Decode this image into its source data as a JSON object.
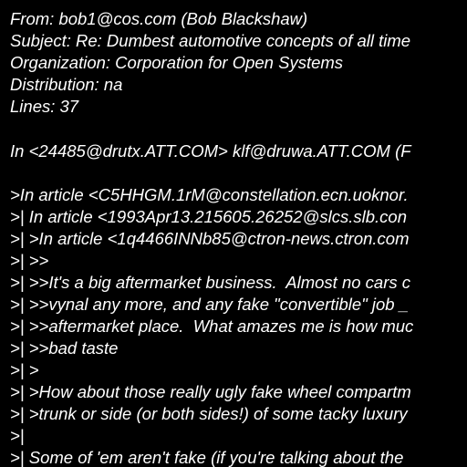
{
  "message": {
    "headers": [
      "From: bob1@cos.com (Bob Blackshaw)",
      "Subject: Re: Dumbest automotive concepts of all time",
      "Organization: Corporation for Open Systems",
      "Distribution: na",
      "Lines: 37"
    ],
    "body": [
      "In <24485@drutx.ATT.COM> klf@druwa.ATT.COM (F",
      ">In article <C5HHGM.1rM@constellation.ecn.uoknor.",
      ">| In article <1993Apr13.215605.26252@slcs.slb.con",
      ">| >In article <1q4466INNb85@ctron-news.ctron.com",
      ">| >>",
      ">| >>It's a big aftermarket business.  Almost no cars c",
      ">| >>vynal any more, and any fake \"convertible\" job _",
      ">| >>aftermarket place.  What amazes me is how muc",
      ">| >>bad taste",
      ">| >",
      ">| >How about those really ugly fake wheel compartm",
      ">| >trunk or side (or both sides!) of some tacky luxury",
      ">|",
      ">| Some of 'em aren't fake (if you're talking about the"
    ]
  }
}
